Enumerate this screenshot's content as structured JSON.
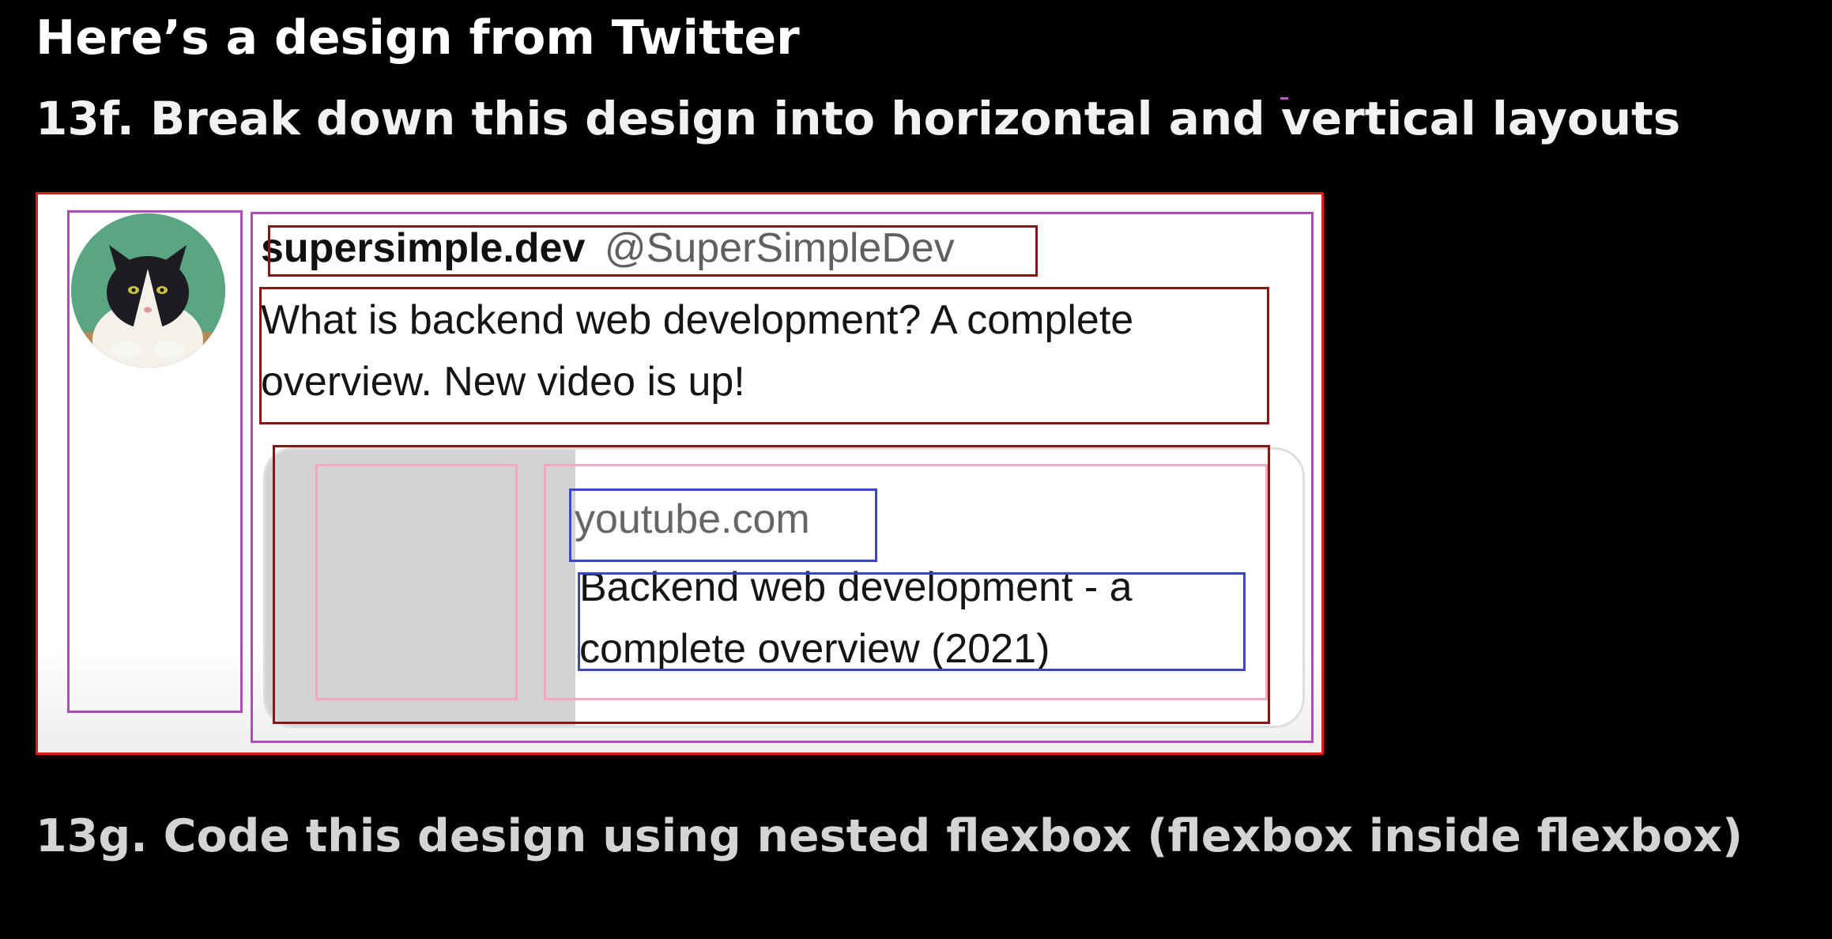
{
  "slide": {
    "title": "Here’s a design from Twitter",
    "subtitle": "13f. Break down this design into horizontal and vertical layouts",
    "footer": "13g. Code this design using nested flexbox (flexbox inside flexbox)"
  },
  "tweet": {
    "display_name": "supersimple.dev",
    "handle": "@SuperSimpleDev",
    "text": "What is backend web development? A complete overview. New video is up!",
    "link_card": {
      "domain": "youtube.com",
      "title": "Backend web development - a complete overview (2021)"
    }
  },
  "colors": {
    "background": "#000000",
    "outline_red": "#e01a1a",
    "outline_purple": "#b04cb8",
    "outline_maroon": "#8b1414",
    "outline_pink": "#f3a7c2",
    "outline_blue": "#3b46c4",
    "avatar_background": "#5aa681",
    "thumbnail_placeholder": "#d3d3d3"
  }
}
